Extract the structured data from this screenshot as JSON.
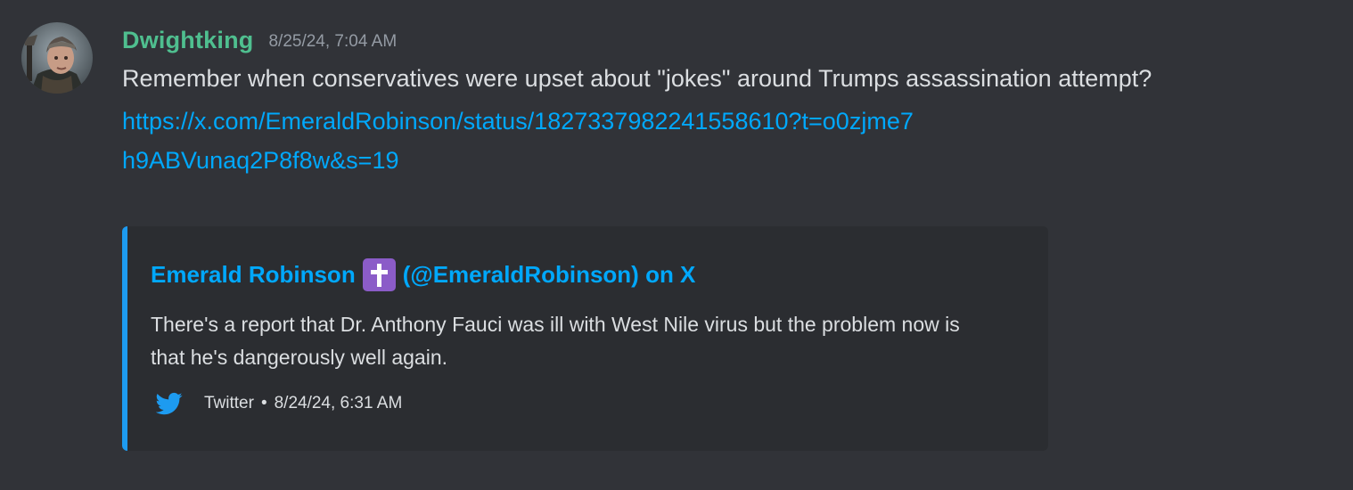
{
  "message": {
    "username": "Dwightking",
    "timestamp": "8/25/24, 7:04 AM",
    "text": "Remember when conservatives were upset about \"jokes\" around Trumps assassination attempt?",
    "link": "https://x.com/EmeraldRobinson/status/1827337982241558610?t=o0zjme7h9ABVunaq2P8f8w&s=19"
  },
  "embed": {
    "author_name": "Emerald Robinson",
    "author_handle": "(@EmeraldRobinson) on X",
    "badge_glyph": "✝",
    "description": "There's a report that Dr. Anthony Fauci was ill with West Nile virus but the problem now is that he's dangerously well again.",
    "footer_source": "Twitter",
    "footer_separator": "•",
    "footer_time": "8/24/24, 6:31 AM",
    "footer_icon": "twitter-bird-icon"
  },
  "colors": {
    "background": "#313338",
    "embed_background": "#2b2d31",
    "embed_accent": "#1d9bf0",
    "username": "#4fbf8f",
    "link": "#00a8fc",
    "badge": "#8b5cc8"
  }
}
